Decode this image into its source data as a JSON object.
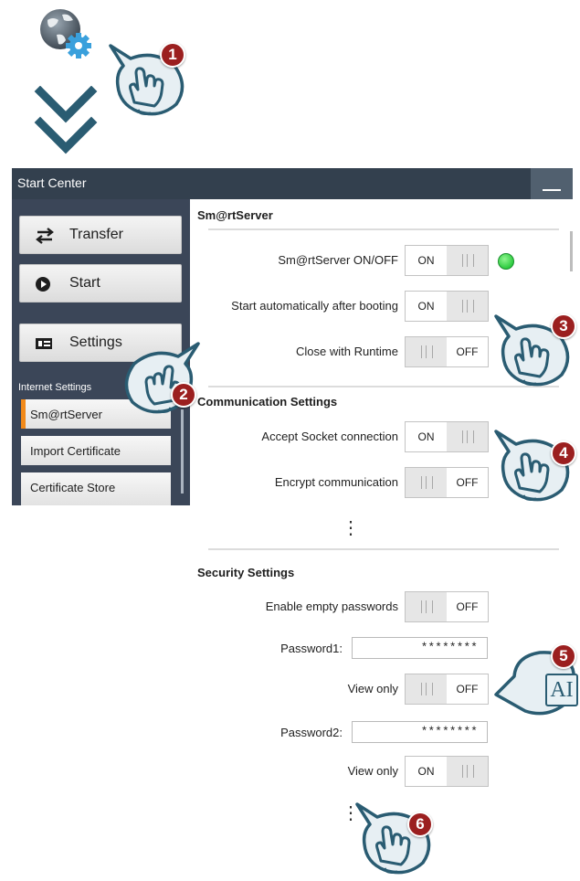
{
  "window": {
    "title": "Start Center"
  },
  "sidebar": {
    "transfer_label": "Transfer",
    "start_label": "Start",
    "settings_label": "Settings",
    "internet_settings_heading": "Internet Settings",
    "items": [
      {
        "label": "Sm@rtServer",
        "active": true
      },
      {
        "label": "Import Certificate",
        "active": false
      },
      {
        "label": "Certificate Store",
        "active": false
      }
    ]
  },
  "smartserver": {
    "title": "Sm@rtServer",
    "on_off_label": "Sm@rtServer ON/OFF",
    "on_off_state": "ON",
    "status_color": "#2ecc40",
    "autostart_label": "Start automatically after booting",
    "autostart_state": "ON",
    "close_runtime_label": "Close with Runtime",
    "close_runtime_state": "OFF"
  },
  "communication": {
    "title": "Communication Settings",
    "socket_label": "Accept Socket connection",
    "socket_state": "ON",
    "encrypt_label": "Encrypt communication",
    "encrypt_state": "OFF"
  },
  "security": {
    "title": "Security Settings",
    "empty_pw_label": "Enable empty passwords",
    "empty_pw_state": "OFF",
    "password1_label": "Password1:",
    "password1_value": "********",
    "view_only1_label": "View only",
    "view_only1_state": "OFF",
    "password2_label": "Password2:",
    "password2_value": "********",
    "view_only2_label": "View only",
    "view_only2_state": "ON"
  },
  "ellipsis": "⋮",
  "callouts": [
    "1",
    "2",
    "3",
    "4",
    "5",
    "6"
  ],
  "keyboard_icon_text": "AI",
  "colors": {
    "titlebar": "#33404e",
    "sidebar": "#3b4658",
    "active_accent": "#f28a1a",
    "callout_teal": "#2a5c72",
    "badge_red": "#9b1f1f"
  },
  "icons": [
    "globe-gear-icon",
    "double-chevron-down-icon",
    "transfer-arrows-icon",
    "play-icon",
    "settings-panel-icon",
    "hand-pointer-icon",
    "text-input-icon"
  ]
}
